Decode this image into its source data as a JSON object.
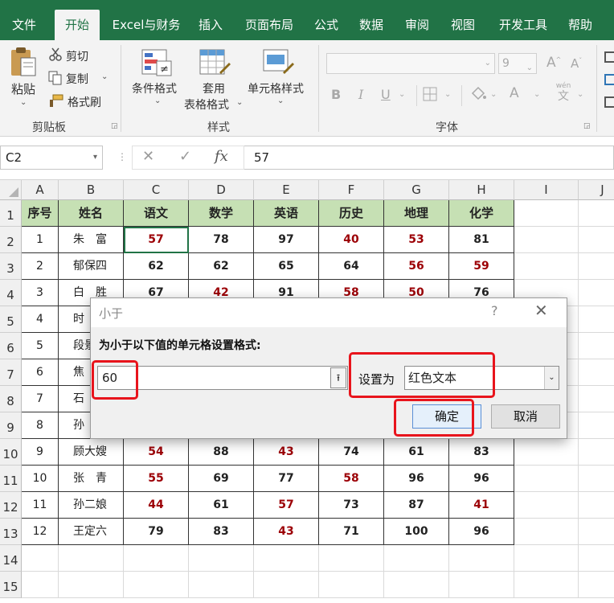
{
  "ribbon_tabs": [
    "文件",
    "开始",
    "Excel与财务",
    "插入",
    "页面布局",
    "公式",
    "数据",
    "审阅",
    "视图",
    "开发工具",
    "帮助"
  ],
  "active_tab": "开始",
  "clipboard": {
    "paste": "粘贴",
    "cut": "剪切",
    "copy": "复制",
    "format_painter": "格式刷",
    "group": "剪贴板"
  },
  "styles": {
    "conditional": "条件格式",
    "table_line1": "套用",
    "table_line2": "表格格式",
    "cell_styles": "单元格样式",
    "group": "样式"
  },
  "font": {
    "size": "9",
    "group": "字体",
    "bold": "B",
    "italic": "I",
    "underline": "U",
    "grow": "A",
    "shrink": "A",
    "color": "A",
    "wen": "wén",
    "wen_char": "文"
  },
  "formula_bar": {
    "name_box": "C2",
    "cancel": "✕",
    "enter": "✓",
    "fx": "fx",
    "value": "57"
  },
  "columns": [
    "A",
    "B",
    "C",
    "D",
    "E",
    "F",
    "G",
    "H",
    "I",
    "J"
  ],
  "row_numbers": [
    "1",
    "2",
    "3",
    "4",
    "5",
    "6",
    "7",
    "8",
    "9",
    "10",
    "11",
    "12",
    "13",
    "14",
    "15"
  ],
  "table": {
    "headers": [
      "序号",
      "姓名",
      "语文",
      "数学",
      "英语",
      "历史",
      "地理",
      "化学"
    ],
    "rows": [
      [
        "1",
        "朱　富",
        "57",
        "78",
        "97",
        "40",
        "53",
        "81"
      ],
      [
        "2",
        "郁保四",
        "62",
        "62",
        "65",
        "64",
        "56",
        "59"
      ],
      [
        "3",
        "白　胜",
        "67",
        "42",
        "91",
        "58",
        "50",
        "76"
      ],
      [
        "4",
        "时",
        "",
        "",
        "",
        "",
        "",
        ""
      ],
      [
        "5",
        "段景",
        "",
        "",
        "",
        "",
        "",
        ""
      ],
      [
        "6",
        "焦",
        "",
        "",
        "",
        "",
        "",
        ""
      ],
      [
        "7",
        "石",
        "",
        "",
        "",
        "",
        "",
        ""
      ],
      [
        "8",
        "孙",
        "",
        "",
        "",
        "",
        "",
        ""
      ],
      [
        "9",
        "顾大嫂",
        "54",
        "88",
        "43",
        "74",
        "61",
        "83"
      ],
      [
        "10",
        "张　青",
        "55",
        "69",
        "77",
        "58",
        "96",
        "96"
      ],
      [
        "11",
        "孙二娘",
        "44",
        "61",
        "57",
        "73",
        "87",
        "41"
      ],
      [
        "12",
        "王定六",
        "79",
        "83",
        "43",
        "71",
        "100",
        "96"
      ]
    ]
  },
  "dialog": {
    "title": "小于",
    "help": "?",
    "close": "✕",
    "prompt": "为小于以下值的单元格设置格式:",
    "value": "60",
    "collapse_icon": "⭱",
    "set_label": "设置为",
    "format": "红色文本",
    "ok": "确定",
    "cancel": "取消"
  },
  "colors": {
    "excel_green": "#217346",
    "header_fill": "#c6e0b4",
    "red_text": "#9c0006",
    "highlight": "#e8141c"
  }
}
